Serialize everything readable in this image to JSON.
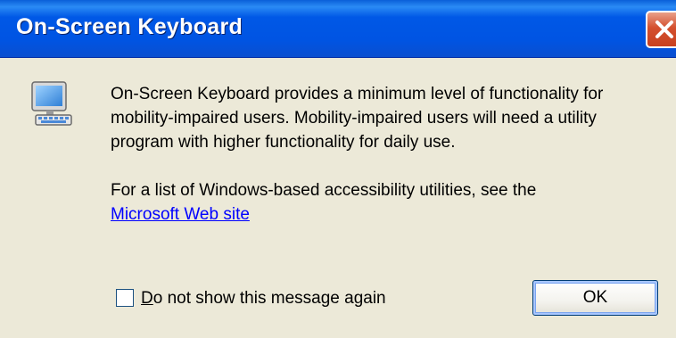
{
  "window": {
    "title": "On-Screen Keyboard",
    "close_label": "Close"
  },
  "icons": {
    "app": "on-screen-keyboard-monitor-icon",
    "close": "close-x-icon"
  },
  "message": {
    "line1": "On-Screen Keyboard provides a minimum level of functionality for",
    "line2": "mobility-impaired users. Mobility-impaired users will need a utility",
    "line3": "program with higher functionality for daily use.",
    "line4": "For a list of Windows-based accessibility utilities, see the",
    "link": "Microsoft Web site"
  },
  "checkbox": {
    "mnemonic": "D",
    "label_rest": "o not show this message again",
    "checked": false
  },
  "buttons": {
    "ok": "OK"
  },
  "colors": {
    "titlebar": "#0054e3",
    "dialog_bg": "#ece9d8",
    "close_button": "#d4502e",
    "link": "#0000ff"
  }
}
